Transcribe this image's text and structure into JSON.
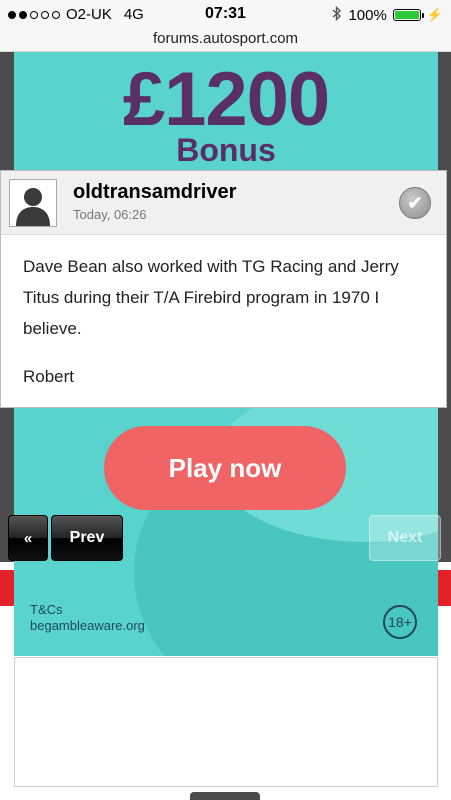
{
  "status_bar": {
    "carrier": "O2-UK",
    "network": "4G",
    "time": "07:31",
    "battery_percent": "100%",
    "battery_level": 1.0,
    "signal_bars_filled": 2,
    "signal_bars_total": 5
  },
  "browser": {
    "url": "forums.autosport.com"
  },
  "ad": {
    "amount": "£1200",
    "bonus": "Bonus",
    "cta": "Play now",
    "tcs": "T&Cs",
    "gamble_aware": "begambleaware.org",
    "age_badge": "18+",
    "colors": {
      "background": "#58d3cd",
      "headline": "#5a2f66",
      "button": "#f06466"
    }
  },
  "post": {
    "username": "oldtransamdriver",
    "timestamp": "Today, 06:26",
    "body": "Dave Bean also worked with TG Racing and Jerry Titus during their T/A Firebird program in 1970 I believe.",
    "signature": "Robert",
    "avatar_icon": "default-user-silhouette",
    "status_icon": "checkmark-icon"
  },
  "pager": {
    "first_label": "«",
    "prev_label": "Prev",
    "next_label": "Next"
  }
}
